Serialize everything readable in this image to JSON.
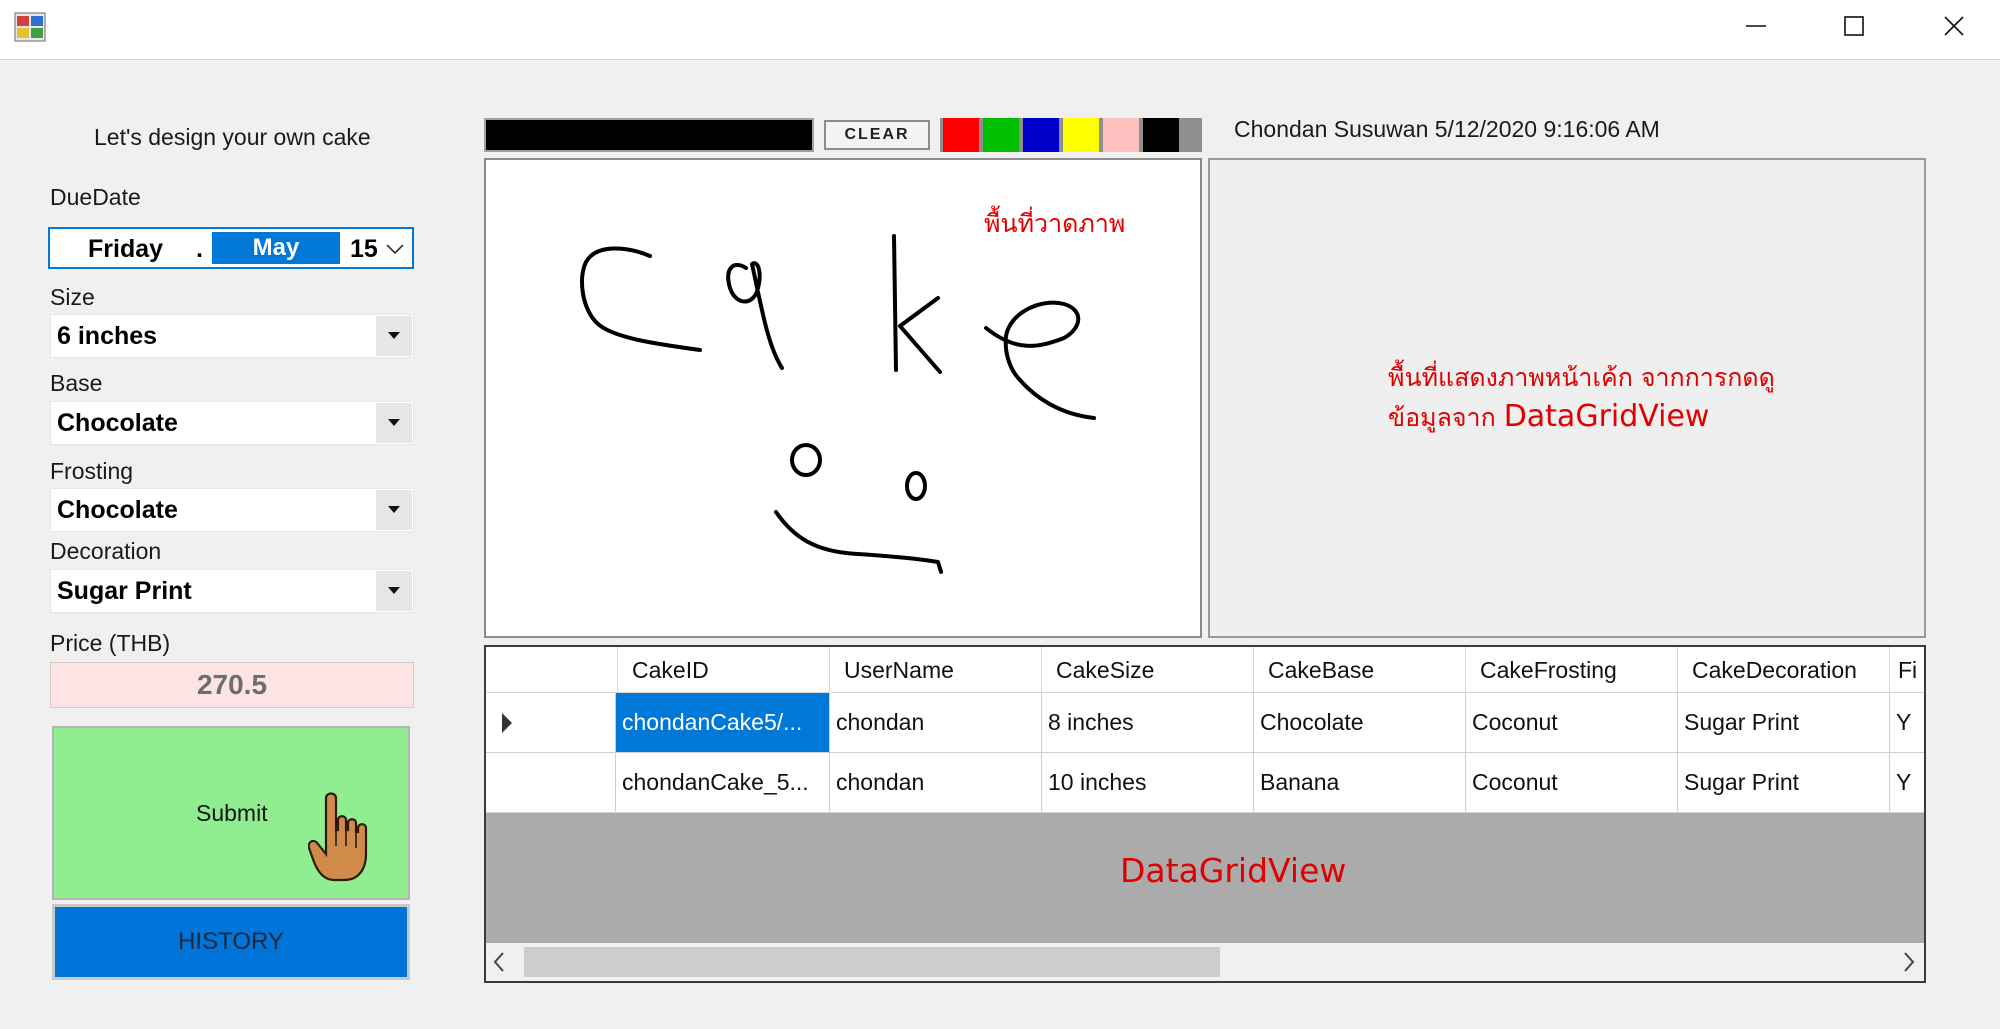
{
  "window": {
    "icons": [
      "app-icon",
      "minimize-icon",
      "maximize-icon",
      "close-icon"
    ]
  },
  "form": {
    "heading": "Let's design your own cake",
    "due_date": {
      "label": "DueDate",
      "weekday": "Friday",
      "separator": ".",
      "month": "May",
      "day": "15"
    },
    "size": {
      "label": "Size",
      "value": "6 inches"
    },
    "base": {
      "label": "Base",
      "value": "Chocolate"
    },
    "frosting": {
      "label": "Frosting",
      "value": "Chocolate"
    },
    "decoration": {
      "label": "Decoration",
      "value": "Sugar Print"
    },
    "price": {
      "label": "Price (THB)",
      "value": "270.5"
    },
    "submit_label": "Submit",
    "history_label": "HISTORY"
  },
  "toolbar": {
    "pen_color": "#000000",
    "clear_label": "CLEAR",
    "palette": [
      "#ff0000",
      "#00c000",
      "#0000c8",
      "#ffff00",
      "#ffc0c0",
      "#000000"
    ]
  },
  "user_stamp": "Chondan Susuwan 5/12/2020 9:16:06 AM",
  "canvas": {
    "note": "พื้นที่วาดภาพ",
    "drawing_text": "cake"
  },
  "preview": {
    "note_line1": "พื้นที่แสดงภาพหน้าเค้ก จากการกดดู",
    "note_line2_prefix": "ข้อมูลจาก ",
    "note_line2_emph": "DataGridView"
  },
  "grid": {
    "columns": [
      "CakeID",
      "UserName",
      "CakeSize",
      "CakeBase",
      "CakeFrosting",
      "CakeDecoration",
      "Fi"
    ],
    "rows": [
      [
        "chondanCake5/...",
        "chondan",
        "8 inches",
        "Chocolate",
        "Coconut",
        "Sugar Print",
        "Y"
      ],
      [
        "chondanCake_5...",
        "chondan",
        "10 inches",
        "Banana",
        "Coconut",
        "Sugar Print",
        "Y"
      ]
    ],
    "label": "DataGridView"
  }
}
